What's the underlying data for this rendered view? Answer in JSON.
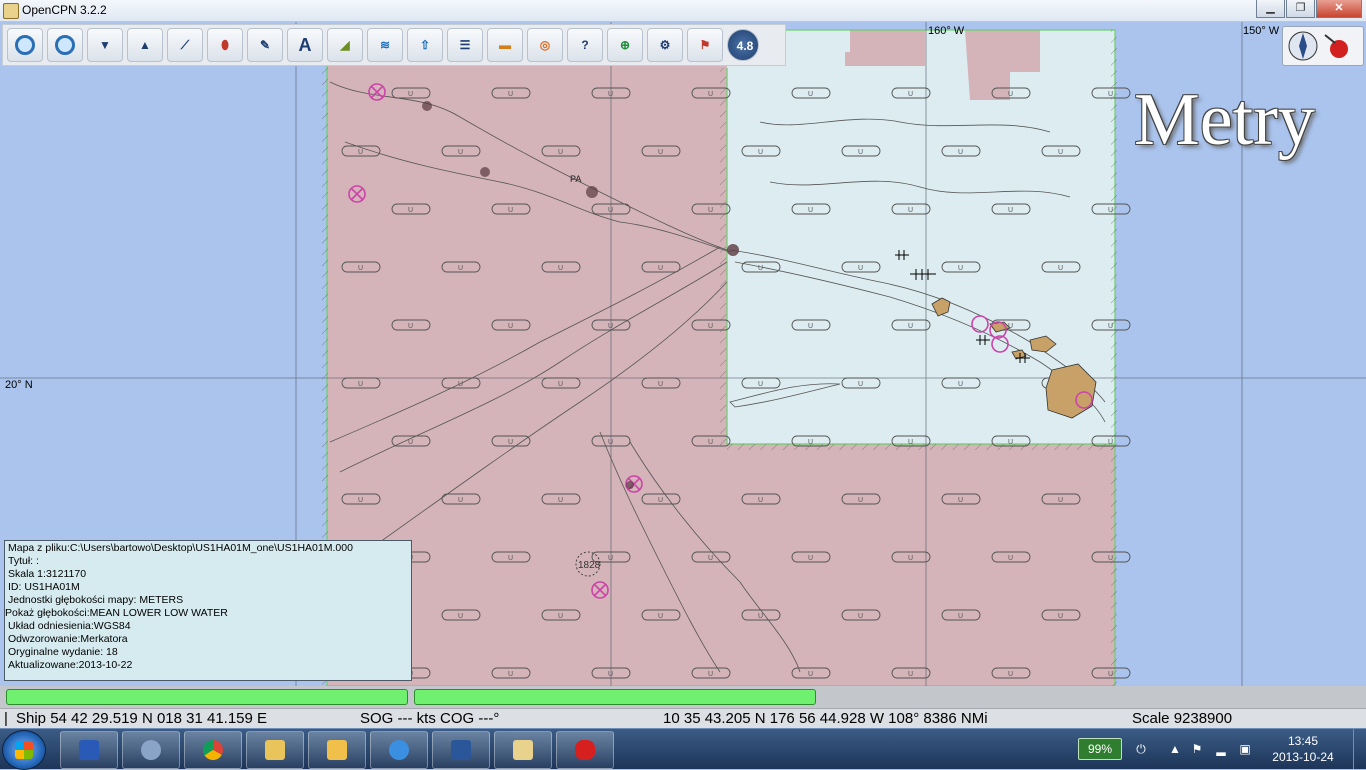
{
  "window": {
    "title": "OpenCPN 3.2.2",
    "controls": [
      "minimize-icon",
      "maximize-icon",
      "close-icon"
    ]
  },
  "toolbar": {
    "tools": [
      {
        "name": "zoom-in",
        "icon": "zoom-in-icon"
      },
      {
        "name": "zoom-out",
        "icon": "zoom-out-icon"
      },
      {
        "name": "scale-in",
        "icon": "chart-scale-in-icon"
      },
      {
        "name": "scale-out",
        "icon": "chart-scale-out-icon"
      },
      {
        "name": "route",
        "icon": "route-icon"
      },
      {
        "name": "auto-follow",
        "icon": "boat-icon"
      },
      {
        "name": "settings",
        "icon": "wrench-icon"
      },
      {
        "name": "text",
        "icon": "text-add-icon"
      },
      {
        "name": "current",
        "icon": "current-icon"
      },
      {
        "name": "tide",
        "icon": "tide-icon"
      },
      {
        "name": "current-arrow",
        "icon": "current-arrow-icon"
      },
      {
        "name": "route-manager",
        "icon": "route-manager-icon"
      },
      {
        "name": "color-scheme",
        "icon": "sunset-icon"
      },
      {
        "name": "mob",
        "icon": "lifebuoy-icon"
      },
      {
        "name": "help",
        "icon": "help-icon"
      },
      {
        "name": "ais",
        "icon": "target-icon"
      },
      {
        "name": "plugins",
        "icon": "plugins-icon"
      },
      {
        "name": "print",
        "icon": "life-ring-flag-icon"
      },
      {
        "name": "version",
        "icon": "version-icon",
        "label": "4.8"
      }
    ]
  },
  "map": {
    "overlay_label": "Metry",
    "grid_labels": {
      "lon_160w": "160° W",
      "lon_150w": "150° W",
      "lat_20n": "20° N"
    },
    "sounding_label": "1828",
    "place_label": "PA",
    "colors": {
      "ocean": "#aac4ee",
      "chart_unsurveyed": "#d4b3b9",
      "chart_surveyed": "#dcecf0",
      "land": "#c7a167",
      "chart_border": "#6bd06b"
    }
  },
  "info_panel": {
    "lines": [
      "Mapa z pliku:C:\\Users\\bartowo\\Desktop\\US1HA01M_one\\US1HA01M.000",
      "Tytuł: :",
      "Skala 1:3121170",
      "ID:  US1HA01M",
      "Jednostki głębokości mapy: METERS",
      "Pokaż głębokości:MEAN LOWER LOW WATER",
      "Układ odniesienia:WGS84",
      "Odwzorowanie:Merkatora",
      "Oryginalne wydanie:  18",
      "Aktualizowane:2013-10-22"
    ]
  },
  "status": {
    "ship": "Ship 54 42 29.519 N   018 31 41.159 E",
    "sog_cog": "SOG --- kts  COG ---°",
    "cursor": "10 35 43.205 N   176 56 44.928 W 108°  8386 NMi",
    "scale": "Scale 9238900"
  },
  "taskbar": {
    "items": [
      {
        "name": "taskbar-item-media",
        "icon": "media-player-icon"
      },
      {
        "name": "taskbar-item-mail",
        "icon": "mail-icon"
      },
      {
        "name": "taskbar-item-chrome",
        "icon": "chrome-icon"
      },
      {
        "name": "taskbar-item-explorer",
        "icon": "folder-icon"
      },
      {
        "name": "taskbar-item-outlook",
        "icon": "outlook-icon"
      },
      {
        "name": "taskbar-item-ie",
        "icon": "internet-explorer-icon"
      },
      {
        "name": "taskbar-item-word",
        "icon": "word-icon"
      },
      {
        "name": "taskbar-item-opencpn",
        "icon": "opencpn-icon"
      },
      {
        "name": "taskbar-item-paint",
        "icon": "splash-icon"
      }
    ],
    "battery": "99%",
    "clock_time": "13:45",
    "clock_date": "2013-10-24"
  }
}
